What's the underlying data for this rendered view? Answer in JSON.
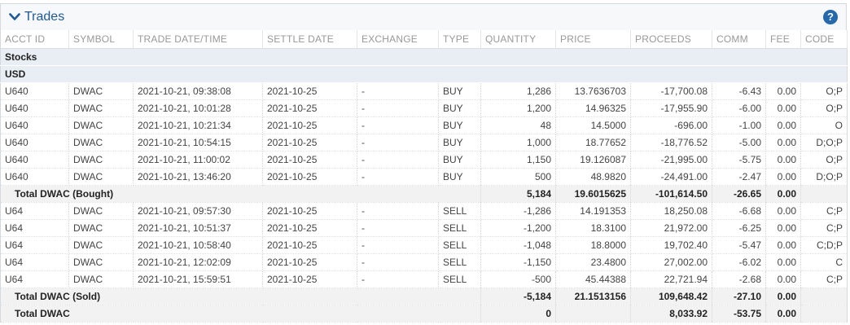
{
  "panel": {
    "title": "Trades",
    "help_label": "?"
  },
  "columns": [
    "ACCT ID",
    "SYMBOL",
    "TRADE DATE/TIME",
    "SETTLE DATE",
    "EXCHANGE",
    "TYPE",
    "QUANTITY",
    "PRICE",
    "PROCEEDS",
    "COMM",
    "FEE",
    "CODE"
  ],
  "asset_class": "Stocks",
  "currency": "USD",
  "bought": [
    {
      "acct": "U640",
      "symbol": "DWAC",
      "datetime": "2021-10-21, 09:38:08",
      "settle": "2021-10-25",
      "exchange": "-",
      "type": "BUY",
      "quantity": "1,286",
      "price": "13.7636703",
      "proceeds": "-17,700.08",
      "comm": "-6.43",
      "fee": "0.00",
      "code": "O;P"
    },
    {
      "acct": "U640",
      "symbol": "DWAC",
      "datetime": "2021-10-21, 10:01:28",
      "settle": "2021-10-25",
      "exchange": "-",
      "type": "BUY",
      "quantity": "1,200",
      "price": "14.96325",
      "proceeds": "-17,955.90",
      "comm": "-6.00",
      "fee": "0.00",
      "code": "O;P"
    },
    {
      "acct": "U640",
      "symbol": "DWAC",
      "datetime": "2021-10-21, 10:21:34",
      "settle": "2021-10-25",
      "exchange": "-",
      "type": "BUY",
      "quantity": "48",
      "price": "14.5000",
      "proceeds": "-696.00",
      "comm": "-1.00",
      "fee": "0.00",
      "code": "O"
    },
    {
      "acct": "U640",
      "symbol": "DWAC",
      "datetime": "2021-10-21, 10:54:15",
      "settle": "2021-10-25",
      "exchange": "-",
      "type": "BUY",
      "quantity": "1,000",
      "price": "18.77652",
      "proceeds": "-18,776.52",
      "comm": "-5.00",
      "fee": "0.00",
      "code": "D;O;P"
    },
    {
      "acct": "U640",
      "symbol": "DWAC",
      "datetime": "2021-10-21, 11:00:02",
      "settle": "2021-10-25",
      "exchange": "-",
      "type": "BUY",
      "quantity": "1,150",
      "price": "19.126087",
      "proceeds": "-21,995.00",
      "comm": "-5.75",
      "fee": "0.00",
      "code": "O;P"
    },
    {
      "acct": "U640",
      "symbol": "DWAC",
      "datetime": "2021-10-21, 13:46:20",
      "settle": "2021-10-25",
      "exchange": "-",
      "type": "BUY",
      "quantity": "500",
      "price": "48.9820",
      "proceeds": "-24,491.00",
      "comm": "-2.47",
      "fee": "0.00",
      "code": "D;O;P"
    }
  ],
  "bought_total": {
    "label": "Total DWAC (Bought)",
    "quantity": "5,184",
    "price": "19.6015625",
    "proceeds": "-101,614.50",
    "comm": "-26.65",
    "fee": "0.00"
  },
  "sold": [
    {
      "acct": "U64",
      "symbol": "DWAC",
      "datetime": "2021-10-21, 09:57:30",
      "settle": "2021-10-25",
      "exchange": "-",
      "type": "SELL",
      "quantity": "-1,286",
      "price": "14.191353",
      "proceeds": "18,250.08",
      "comm": "-6.68",
      "fee": "0.00",
      "code": "C;P"
    },
    {
      "acct": "U64",
      "symbol": "DWAC",
      "datetime": "2021-10-21, 10:51:37",
      "settle": "2021-10-25",
      "exchange": "-",
      "type": "SELL",
      "quantity": "-1,200",
      "price": "18.3100",
      "proceeds": "21,972.00",
      "comm": "-6.25",
      "fee": "0.00",
      "code": "C;P"
    },
    {
      "acct": "U64",
      "symbol": "DWAC",
      "datetime": "2021-10-21, 10:58:40",
      "settle": "2021-10-25",
      "exchange": "-",
      "type": "SELL",
      "quantity": "-1,048",
      "price": "18.8000",
      "proceeds": "19,702.40",
      "comm": "-5.47",
      "fee": "0.00",
      "code": "C;D;P"
    },
    {
      "acct": "U64",
      "symbol": "DWAC",
      "datetime": "2021-10-21, 12:02:09",
      "settle": "2021-10-25",
      "exchange": "-",
      "type": "SELL",
      "quantity": "-1,150",
      "price": "23.4800",
      "proceeds": "27,002.00",
      "comm": "-6.02",
      "fee": "0.00",
      "code": "C"
    },
    {
      "acct": "U64",
      "symbol": "DWAC",
      "datetime": "2021-10-21, 15:59:51",
      "settle": "2021-10-25",
      "exchange": "-",
      "type": "SELL",
      "quantity": "-500",
      "price": "45.44388",
      "proceeds": "22,721.94",
      "comm": "-2.68",
      "fee": "0.00",
      "code": "C;P"
    }
  ],
  "sold_total": {
    "label": "Total DWAC (Sold)",
    "quantity": "-5,184",
    "price": "21.1513156",
    "proceeds": "109,648.42",
    "comm": "-27.10",
    "fee": "0.00"
  },
  "grand_total": {
    "label": "Total DWAC",
    "quantity": "0",
    "price": "",
    "proceeds": "8,033.92",
    "comm": "-53.75",
    "fee": "0.00"
  }
}
